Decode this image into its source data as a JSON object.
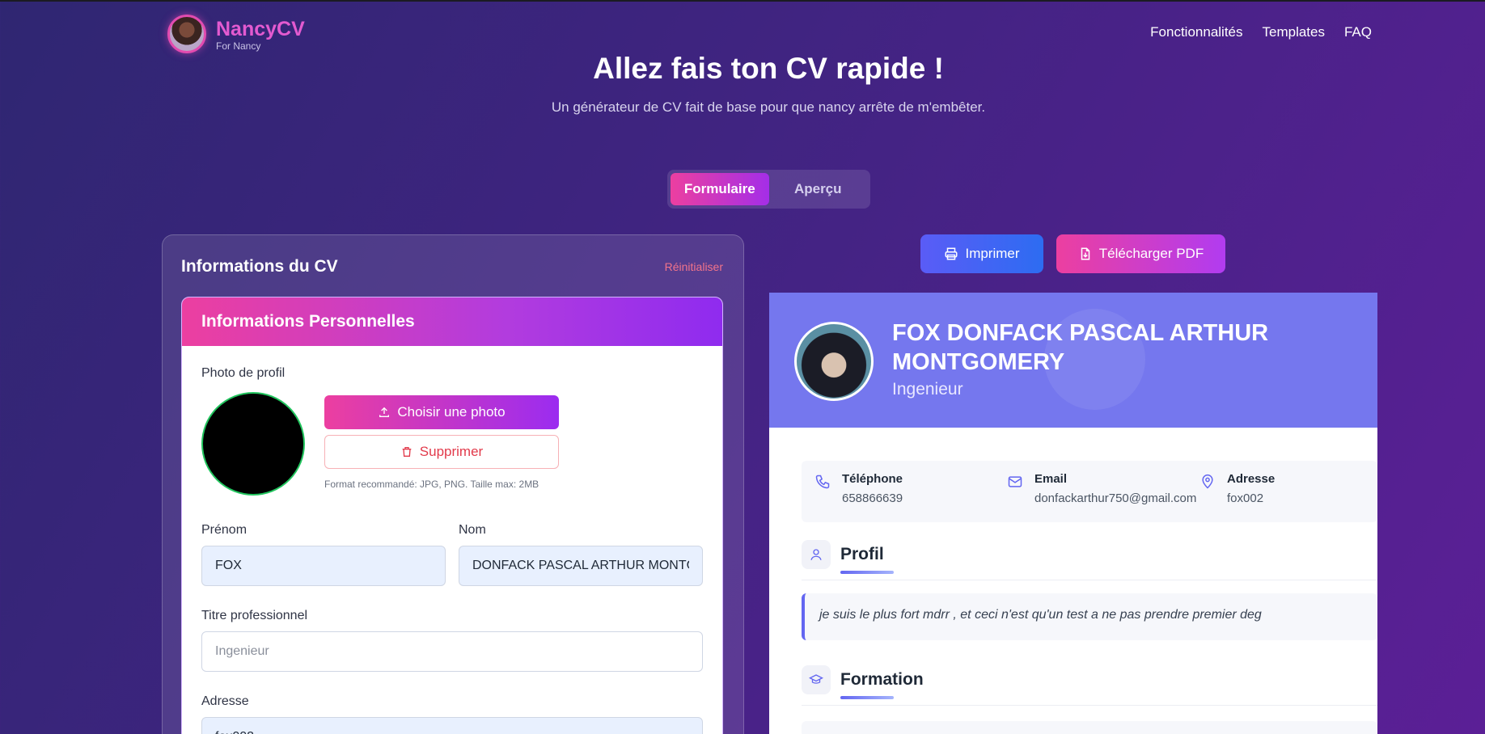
{
  "header": {
    "brand_name": "NancyCV",
    "brand_sub": "For Nancy",
    "nav": [
      "Fonctionnalités",
      "Templates",
      "FAQ"
    ]
  },
  "hero": {
    "title": "Allez fais ton CV rapide !",
    "subtitle": "Un générateur de CV fait de base pour que nancy arrête de m'embêter."
  },
  "toggle": {
    "form": "Formulaire",
    "preview": "Aperçu",
    "active": "form"
  },
  "form": {
    "title": "Informations du CV",
    "reset": "Réinitialiser",
    "section_title": "Informations Personnelles",
    "photo_label": "Photo de profil",
    "choose_photo": "Choisir une photo",
    "delete_photo": "Supprimer",
    "photo_hint": "Format recommandé: JPG, PNG. Taille max: 2MB",
    "prenom_label": "Prénom",
    "prenom_value": "FOX",
    "nom_label": "Nom",
    "nom_value": "DONFACK PASCAL ARTHUR MONTGOMERY",
    "titre_label": "Titre professionnel",
    "titre_placeholder": "Ingenieur",
    "adresse_label": "Adresse",
    "adresse_value": "fox002"
  },
  "actions": {
    "print": "Imprimer",
    "pdf": "Télécharger PDF"
  },
  "cv": {
    "name": "FOX DONFACK PASCAL ARTHUR MONTGOMERY",
    "title": "Ingenieur",
    "contacts": [
      {
        "label": "Téléphone",
        "value": "658866639",
        "icon": "phone-icon"
      },
      {
        "label": "Email",
        "value": "donfackarthur750@gmail.com",
        "icon": "mail-icon"
      },
      {
        "label": "Adresse",
        "value": "fox002",
        "icon": "location-icon"
      }
    ],
    "profile_title": "Profil",
    "profile_text": "je suis le plus fort mdrr , et ceci n'est qu'un test a ne pas prendre premier deg",
    "education_title": "Formation"
  },
  "colors": {
    "accent_pink": "#ec3fa0",
    "accent_purple": "#9b2cf0",
    "cv_header": "#7577ee",
    "danger": "#e23a4b"
  }
}
